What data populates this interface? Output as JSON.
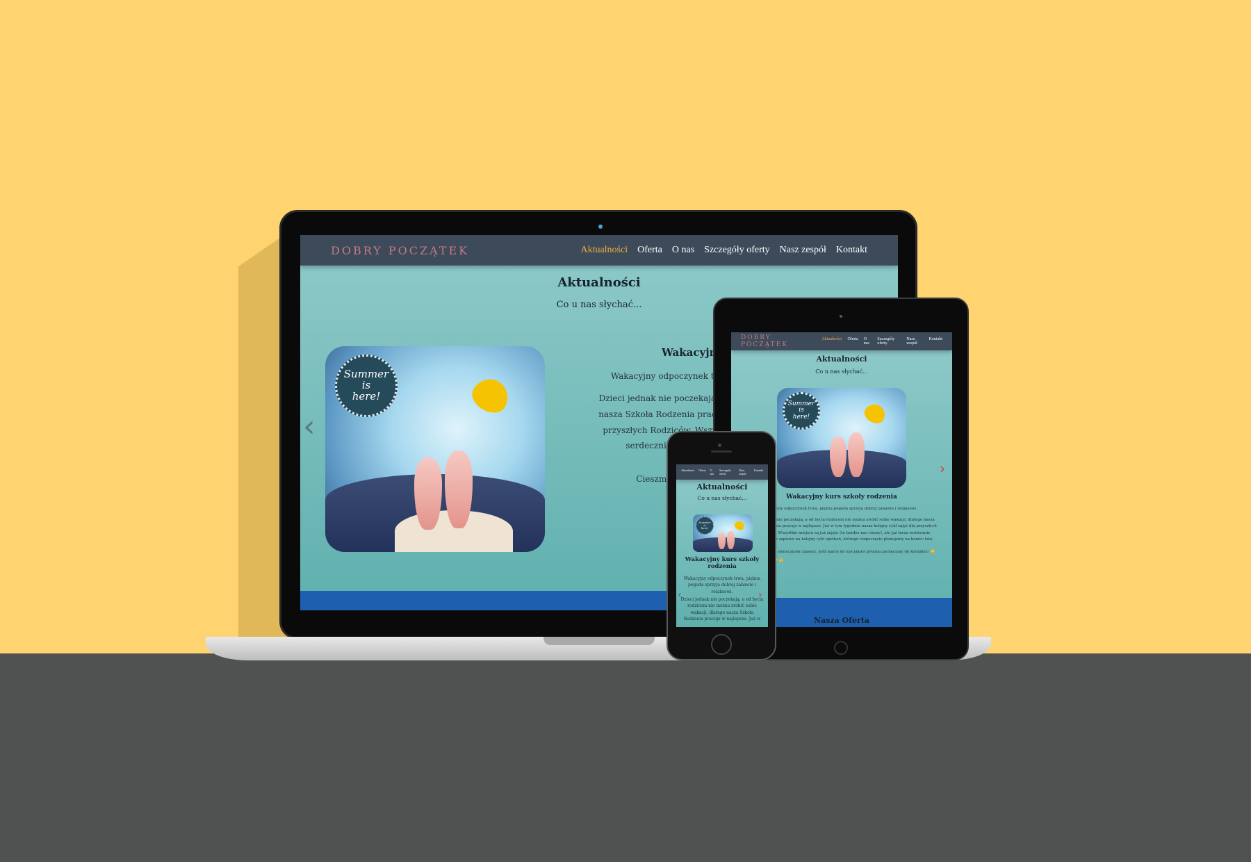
{
  "site": {
    "logo": "DOBRY POCZĄTEK",
    "nav": [
      "Aktualności",
      "Oferta",
      "O nas",
      "Szczegóły oferty",
      "Nasz zespół",
      "Kontakt"
    ],
    "active_nav": "Aktualności"
  },
  "section": {
    "title": "Aktualności",
    "subtitle": "Co u nas słychać..."
  },
  "hero": {
    "stamp_line1": "Summer",
    "stamp_line2": "is",
    "stamp_line3": "here!"
  },
  "laptop": {
    "heading": "Wakacyjny ku",
    "p1": "Wakacyjny odpoczynek trwa, piękna",
    "p2_l1": "Dzieci jednak nie poczekają, a od bycia ro",
    "p2_l2": "nasza Szkoła Rodzenia pracuje w najlepsz",
    "p2_l3": "przyszłych Rodziców. Wszystkie miejsca",
    "p2_l4": "serdecznie zapraszamy do za",
    "p3": "Cieszmy się tym słonecz",
    "arrow_left": "‹"
  },
  "tablet": {
    "heading": "Wakacyjny kurs szkoły rodzenia",
    "p1": "cyjny odpoczynek trwa, piękna pogoda sprzyja dobrej zabawie i relaksowi.",
    "p2_l1": "k nie poczekają, a od bycia rodzicem nie można zrobić sobie wakacji, dlatego nasza",
    "p2_l2": "enia pracuje w najlepsze. Już w tym tygodniu nasza kolejny cykl zajęć dla przyszłych",
    "p2_l3": "w. Wszystkie miejsca są już zajęte (to bardzo nas cieszy), ale już teraz serdecznie",
    "p2_l4": "do zapisów na kolejny cykl spotkań, którego rozpoczęcie planujemy na koniec lata.",
    "p3": "m słonecznym czasem, jeśli macie do nas jakieś pytania zachęcamy do kontaktu! 😊",
    "p4": "😀 👍",
    "arrow_right": "›",
    "offer_title": "Nasza Oferta"
  },
  "phone": {
    "nav": [
      "Aktualności",
      "Oferta",
      "O nas",
      "Szczegóły oferty",
      "Nasz zespół",
      "Kontakt"
    ],
    "heading": "Wakacyjny kurs szkoły rodzenia",
    "p1": "Wakacyjny odpoczynek trwa, piękna pogoda sprzyja dobrej zabawie i relaksowi.",
    "p2": "Dzieci jednak nie poczekają, a od bycia rodzicem nie można zrobić sobie wakacji, dlatego nasza Szkoła Rodzenia pracuje w najlepsze. Już w",
    "arrow_left": "‹",
    "arrow_right": "›"
  },
  "colors": {
    "wall": "#ffd470",
    "desk": "#505252",
    "nav_bg": "#3d4a5a",
    "nav_active": "#f2ae3c",
    "page_bg": "#7fc1c0",
    "band": "#1f5fb0"
  }
}
